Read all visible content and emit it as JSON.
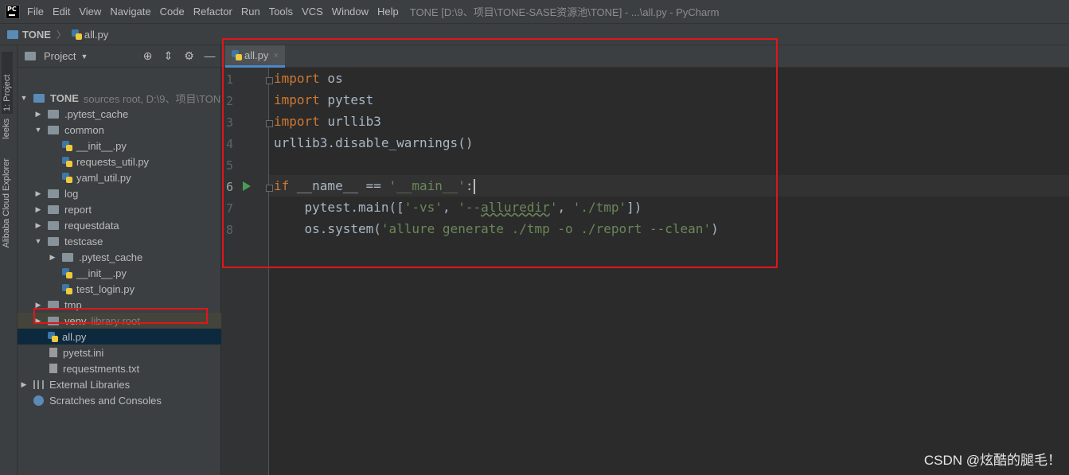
{
  "menubar": {
    "logo_text": "PC",
    "items": [
      "File",
      "Edit",
      "View",
      "Navigate",
      "Code",
      "Refactor",
      "Run",
      "Tools",
      "VCS",
      "Window",
      "Help"
    ],
    "window_title": "TONE [D:\\9、项目\\TONE-SASE资源池\\TONE] - ...\\all.py - PyCharm"
  },
  "breadcrumb": {
    "project": "TONE",
    "file": "all.py"
  },
  "toolstrip": {
    "tabs": [
      "1: Project",
      "leeks",
      "Alibaba Cloud Explorer"
    ]
  },
  "project_panel": {
    "title": "Project",
    "header_icons": [
      "locate-icon",
      "collapse-icon",
      "gear-icon",
      "minimize-icon"
    ],
    "tree": [
      {
        "label": "TONE",
        "hint": "sources root,  D:\\9、项目\\TON",
        "type": "folder-root",
        "indent": 0,
        "arrow": "down"
      },
      {
        "label": ".pytest_cache",
        "hint": "",
        "type": "folder",
        "indent": 1,
        "arrow": "right"
      },
      {
        "label": "common",
        "hint": "",
        "type": "folder-pkg",
        "indent": 1,
        "arrow": "down"
      },
      {
        "label": "__init__.py",
        "hint": "",
        "type": "py",
        "indent": 2,
        "arrow": ""
      },
      {
        "label": "requests_util.py",
        "hint": "",
        "type": "py",
        "indent": 2,
        "arrow": ""
      },
      {
        "label": "yaml_util.py",
        "hint": "",
        "type": "py",
        "indent": 2,
        "arrow": ""
      },
      {
        "label": "log",
        "hint": "",
        "type": "folder",
        "indent": 1,
        "arrow": "right"
      },
      {
        "label": "report",
        "hint": "",
        "type": "folder",
        "indent": 1,
        "arrow": "right"
      },
      {
        "label": "requestdata",
        "hint": "",
        "type": "folder",
        "indent": 1,
        "arrow": "right"
      },
      {
        "label": "testcase",
        "hint": "",
        "type": "folder-pkg",
        "indent": 1,
        "arrow": "down"
      },
      {
        "label": ".pytest_cache",
        "hint": "",
        "type": "folder",
        "indent": 2,
        "arrow": "right"
      },
      {
        "label": "__init__.py",
        "hint": "",
        "type": "py",
        "indent": 2,
        "arrow": ""
      },
      {
        "label": "test_login.py",
        "hint": "",
        "type": "py",
        "indent": 2,
        "arrow": ""
      },
      {
        "label": "tmp",
        "hint": "",
        "type": "folder",
        "indent": 1,
        "arrow": "right"
      },
      {
        "label": "venv",
        "hint": "library root",
        "type": "folder",
        "indent": 1,
        "arrow": "right",
        "state": "lib"
      },
      {
        "label": "all.py",
        "hint": "",
        "type": "py",
        "indent": 1,
        "arrow": "",
        "state": "sel"
      },
      {
        "label": "pyetst.ini",
        "hint": "",
        "type": "txt",
        "indent": 1,
        "arrow": ""
      },
      {
        "label": "requestments.txt",
        "hint": "",
        "type": "txt",
        "indent": 1,
        "arrow": ""
      },
      {
        "label": "External Libraries",
        "hint": "",
        "type": "lib",
        "indent": 0,
        "arrow": "right"
      },
      {
        "label": "Scratches and Consoles",
        "hint": "",
        "type": "scratch",
        "indent": 0,
        "arrow": ""
      }
    ]
  },
  "editor": {
    "tab_label": "all.py",
    "tab_close": "×",
    "current_line": 6,
    "line_numbers": [
      "1",
      "2",
      "3",
      "4",
      "5",
      "6",
      "7",
      "8"
    ]
  },
  "watermark": "CSDN @炫酷的腿毛！",
  "colors": {
    "annotation_red": "#e0161a",
    "keyword": "#cc7832",
    "string": "#6a8759",
    "code_default": "#a9b7c6",
    "run_green": "#499c54"
  }
}
